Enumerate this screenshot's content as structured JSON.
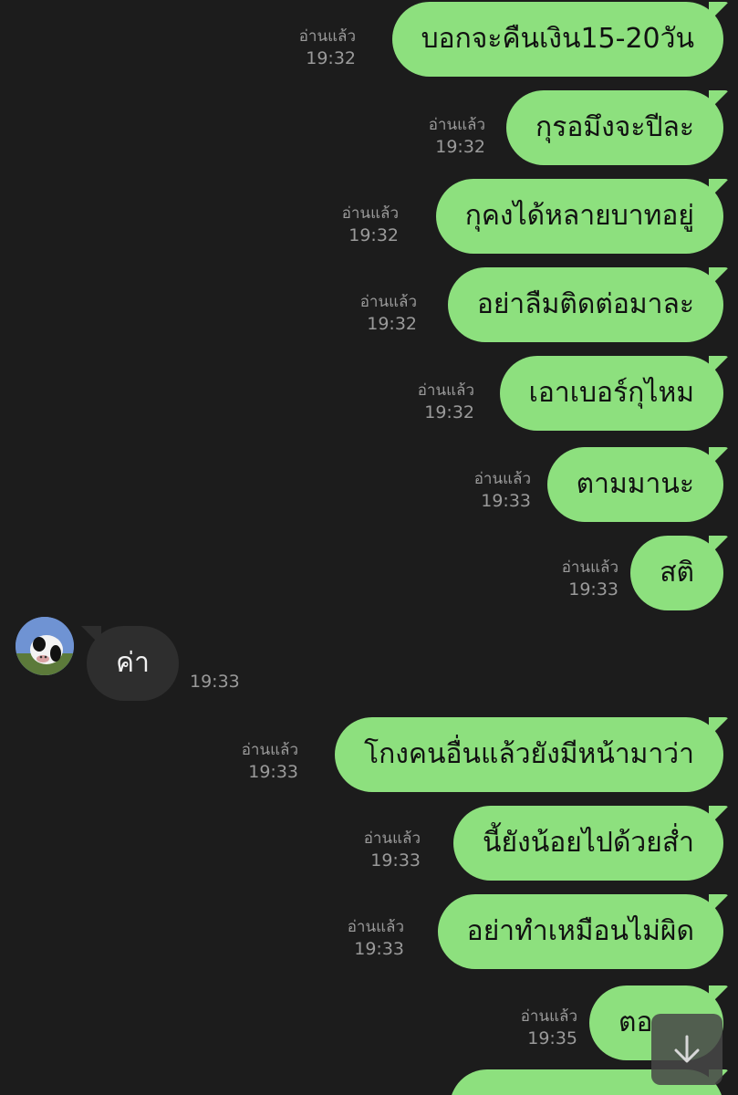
{
  "read_label": "อ่านแล้ว",
  "messages": [
    {
      "text": "บอกจะคืนเงิน15-20วัน",
      "time": "19:32"
    },
    {
      "text": "กุรอมึงจะปีละ",
      "time": "19:32"
    },
    {
      "text": "กุคงได้หลายบาทอยู่",
      "time": "19:32"
    },
    {
      "text": "อย่าลืมติดต่อมาละ",
      "time": "19:32"
    },
    {
      "text": "เอาเบอร์กุไหม",
      "time": "19:32"
    },
    {
      "text": "ตามมานะ",
      "time": "19:33"
    },
    {
      "text": "สติ",
      "time": "19:33"
    },
    {
      "text": "ค่า",
      "time": "19:33",
      "incoming": true
    },
    {
      "text": "โกงคนอื่นแล้วยังมีหน้ามาว่า",
      "time": "19:33"
    },
    {
      "text": "นี้ยังน้อยไปด้วยสํ่า",
      "time": "19:33"
    },
    {
      "text": "อย่าทําเหมือนไม่ผิด",
      "time": "19:33"
    },
    {
      "text": "ตอ",
      "time": "19:35"
    }
  ],
  "icons": {
    "scroll_down": "arrow-down-icon",
    "avatar": "avatar-cow"
  },
  "colors": {
    "outgoing_bubble": "#8de07e",
    "incoming_bubble": "#2e2e2e",
    "background": "#1c1c1c",
    "meta_text": "#9a9a9a"
  }
}
